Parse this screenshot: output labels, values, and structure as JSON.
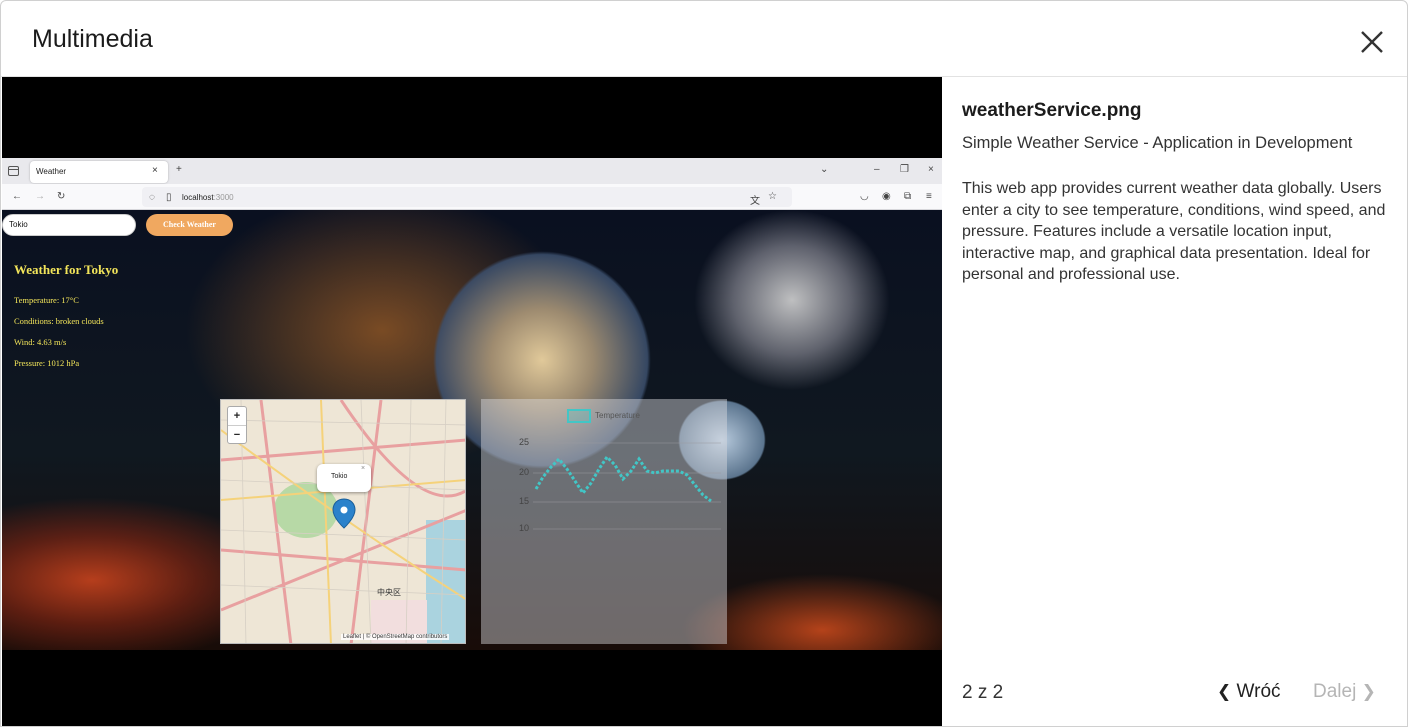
{
  "modal": {
    "title": "Multimedia",
    "close_icon": "close-icon"
  },
  "screenshot": {
    "tab_title": "Weather",
    "url_host": "localhost",
    "url_port": ":3000",
    "city_value": "Tokio",
    "check_button": "Check Weather",
    "weather_title": "Weather for Tokyo",
    "temperature": "Temperature: 17°C",
    "conditions": "Conditions: broken clouds",
    "wind": "Wind: 4.63 m/s",
    "pressure": "Pressure: 1012 hPa",
    "map": {
      "zoom_in": "+",
      "zoom_out": "−",
      "popup_text": "Tokio",
      "popup_close": "×",
      "ward_label": "中央区",
      "attribution": "Leaflet | © OpenStreetMap contributors"
    },
    "chart": {
      "legend_label": "Temperature",
      "y_ticks": [
        "25",
        "20",
        "15",
        "10"
      ],
      "accent_color": "#42c6c6"
    }
  },
  "sidebar": {
    "file_name": "weatherService.png",
    "caption": "Simple Weather Service - Application in Development",
    "description": "This web app provides current weather data globally. Users enter a city to see temperature, conditions, wind speed, and pressure. Features include a versatile location input, interactive map, and graphical data presentation. Ideal for personal and professional use.",
    "counter": "2 z 2",
    "prev_label": "Wróć",
    "next_label": "Dalej"
  }
}
